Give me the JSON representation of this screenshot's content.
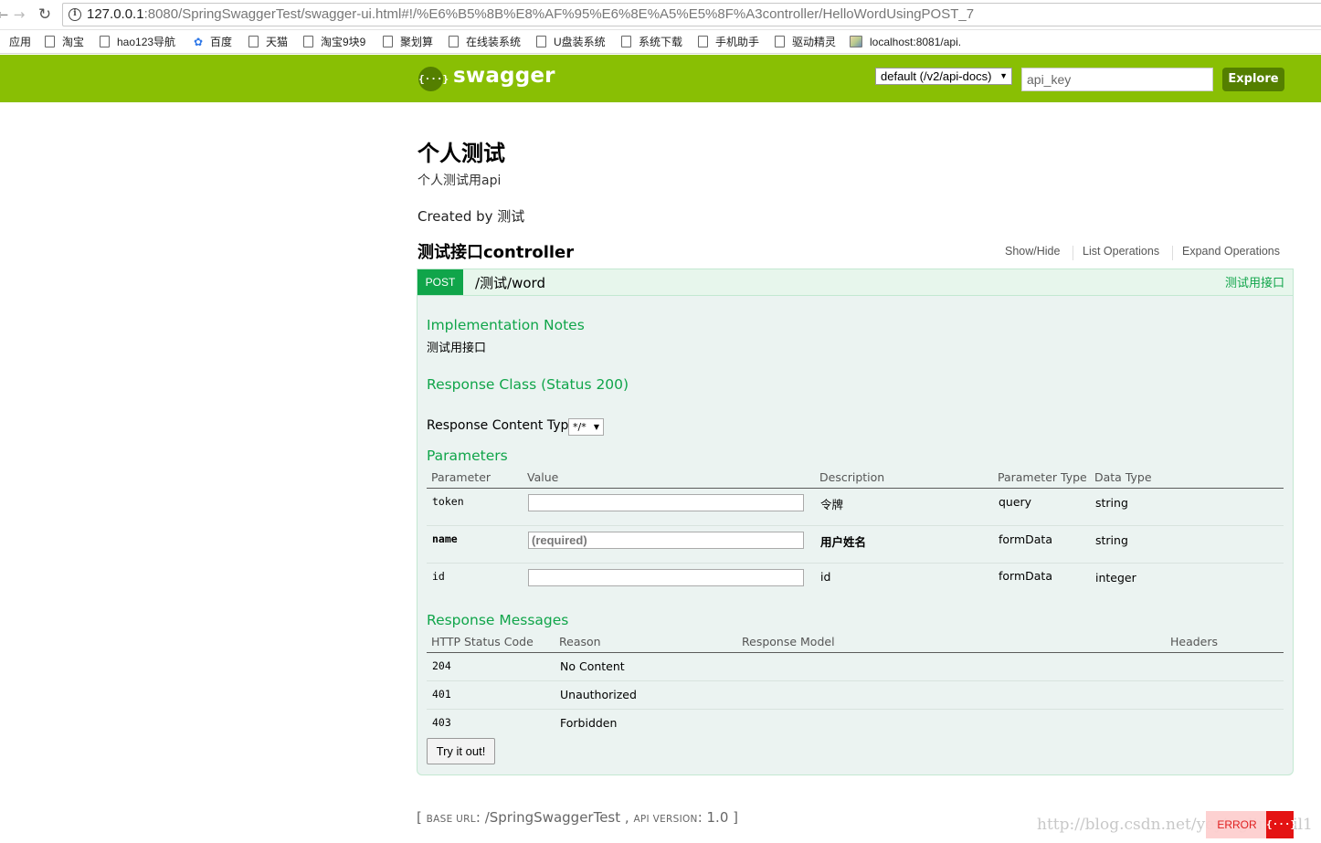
{
  "browser": {
    "url_host": "127.0.0.1",
    "url_rest": ":8080/SpringSwaggerTest/swagger-ui.html#!/%E6%B5%8B%E8%AF%95%E6%8E%A5%E5%8F%A3controller/HelloWordUsingPOST_7",
    "bookmarks": [
      {
        "label": "应用",
        "icon": "apps"
      },
      {
        "label": "淘宝",
        "icon": "page-icon"
      },
      {
        "label": "hao123导航",
        "icon": "page-icon"
      },
      {
        "label": "百度",
        "icon": "paw-icon"
      },
      {
        "label": "天猫",
        "icon": "page-icon"
      },
      {
        "label": "淘宝9块9",
        "icon": "page-icon"
      },
      {
        "label": "聚划算",
        "icon": "page-icon"
      },
      {
        "label": "在线装系统",
        "icon": "page-icon"
      },
      {
        "label": "U盘装系统",
        "icon": "page-icon"
      },
      {
        "label": "系统下载",
        "icon": "page-icon"
      },
      {
        "label": "手机助手",
        "icon": "page-icon"
      },
      {
        "label": "驱动精灵",
        "icon": "page-icon"
      },
      {
        "label": "localhost:8081/api.",
        "icon": "image-icon"
      }
    ]
  },
  "header": {
    "logo_glyph": "{···}",
    "brand": "swagger",
    "spec_select": "default (/v2/api-docs)",
    "api_key_placeholder": "api_key",
    "explore_label": "Explore",
    "brand_color": "#89bf04"
  },
  "info": {
    "title": "个人测试",
    "description": "个人测试用api",
    "created_by": "Created by 测试"
  },
  "resource": {
    "name": "测试接口controller",
    "actions": [
      "Show/Hide",
      "List Operations",
      "Expand Operations"
    ],
    "operation": {
      "method": "POST",
      "path": "/测试/word",
      "summary": "测试用接口",
      "impl_title": "Implementation Notes",
      "impl_notes": "测试用接口",
      "response_class_title": "Response Class (Status 200)",
      "content_type_label": "Response Content Type",
      "content_type_value": "*/*",
      "params_title": "Parameters",
      "param_headers": [
        "Parameter",
        "Value",
        "Description",
        "Parameter Type",
        "Data Type"
      ],
      "params": [
        {
          "name": "token",
          "placeholder": "",
          "description": "令牌",
          "param_type": "query",
          "data_type": "string",
          "required": false
        },
        {
          "name": "name",
          "placeholder": "(required)",
          "description": "用户姓名",
          "param_type": "formData",
          "data_type": "string",
          "required": true
        },
        {
          "name": "id",
          "placeholder": "",
          "description": "id",
          "param_type": "formData",
          "data_type": "integer",
          "required": false
        }
      ],
      "messages_title": "Response Messages",
      "message_headers": [
        "HTTP Status Code",
        "Reason",
        "Response Model",
        "Headers"
      ],
      "messages": [
        {
          "code": "204",
          "reason": "No Content"
        },
        {
          "code": "401",
          "reason": "Unauthorized"
        },
        {
          "code": "403",
          "reason": "Forbidden"
        }
      ],
      "try_label": "Try it out!",
      "method_color": "#10a54a"
    }
  },
  "footer": {
    "open": "[ ",
    "base_url_label": "Base url",
    "base_url": ": /SpringSwaggerTest , ",
    "api_version_label": "api version",
    "api_version": ": 1.0 ]",
    "watermark": "http://blog.csdn.net/yeyinglingfeil1",
    "error_label": "ERROR",
    "error_glyph": "{···}"
  }
}
